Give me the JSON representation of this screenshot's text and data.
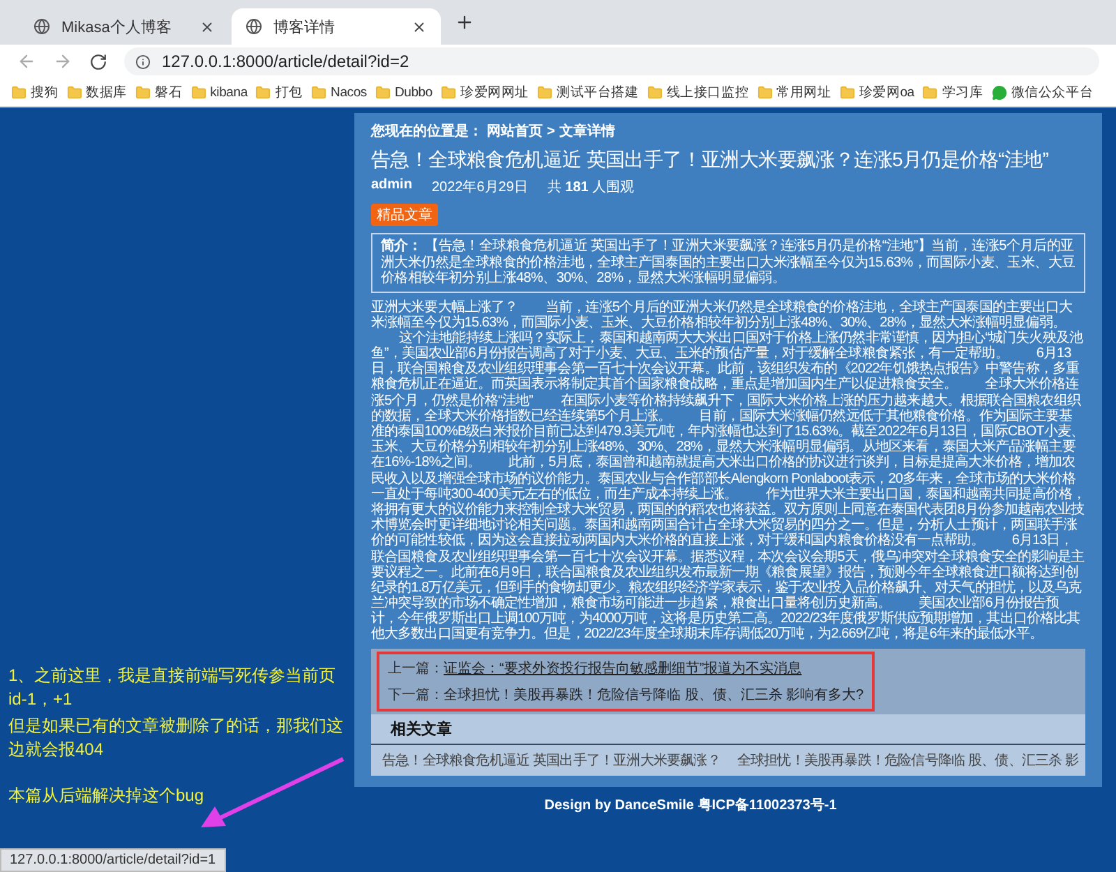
{
  "browser": {
    "tabs": [
      {
        "title": "Mikasa个人博客",
        "selected": false
      },
      {
        "title": "博客详情",
        "selected": true
      }
    ],
    "address": "127.0.0.1:8000/article/detail?id=2",
    "bookmarks": [
      {
        "label": "搜狗",
        "kind": "folder"
      },
      {
        "label": "数据库",
        "kind": "folder"
      },
      {
        "label": "磐石",
        "kind": "folder"
      },
      {
        "label": "kibana",
        "kind": "folder"
      },
      {
        "label": "打包",
        "kind": "folder"
      },
      {
        "label": "Nacos",
        "kind": "folder"
      },
      {
        "label": "Dubbo",
        "kind": "folder"
      },
      {
        "label": "珍爱网网址",
        "kind": "folder"
      },
      {
        "label": "测试平台搭建",
        "kind": "folder"
      },
      {
        "label": "线上接口监控",
        "kind": "folder"
      },
      {
        "label": "常用网址",
        "kind": "folder"
      },
      {
        "label": "珍爱网oa",
        "kind": "folder"
      },
      {
        "label": "学习库",
        "kind": "folder"
      },
      {
        "label": "微信公众平台",
        "kind": "chat"
      }
    ]
  },
  "breadcrumb": {
    "label": "您现在的位置是：",
    "items": [
      "网站首页",
      "文章详情"
    ],
    "separator": ">"
  },
  "article": {
    "title": "告急！全球粮食危机逼近 英国出手了！亚洲大米要飙涨？连涨5月仍是价格“洼地”",
    "author": "admin",
    "date": "2022年6月29日",
    "views": "共 **181** 人围观",
    "badge": "精品文章",
    "summary": "**简介：** 【告急！全球粮食危机逼近 英国出手了！亚洲大米要飙涨？连涨5月仍是价格“洼地”】当前，连涨5个月后的亚洲大米仍然是全球粮食的价格洼地，全球主产国泰国的主要出口大米涨幅至今仅为15.63%，而国际小麦、玉米、大豆价格相较年初分别上涨48%、30%、28%，显然大米涨幅明显偏弱。",
    "body": [
      "亚洲大米要大幅上涨了？",
      "当前，连涨5个月后的亚洲大米仍然是全球粮食的价格洼地，全球主产国泰国的主要出口大米涨幅至今仅为15.63%，而国际小麦、玉米、大豆价格相较年初分别上涨48%、30%、28%，显然大米涨幅明显偏弱。",
      "这个洼地能持续上涨吗？实际上，泰国和越南两大大米出口国对于价格上涨仍然非常谨慎，因为担心“城门失火殃及池鱼”，美国农业部6月份报告调高了对于小麦、大豆、玉米的预估产量，对于缓解全球粮食紧张，有一定帮助。",
      "6月13日，联合国粮食及农业组织理事会第一百七十次会议开幕。此前，该组织发布的《2022年饥饿热点报告》中警告称，多重粮食危机正在逼近。而英国表示将制定其首个国家粮食战略，重点是增加国内生产以促进粮食安全。",
      "全球大米价格连涨5个月，仍然是价格“洼地”",
      "在国际小麦等价格持续飙升下，国际大米价格上涨的压力越来越大。根据联合国粮农组织的数据，全球大米价格指数已经连续第5个月上涨。",
      "目前，国际大米涨幅仍然远低于其他粮食价格。作为国际主要基准的泰国100%B级白米报价目前已达到479.3美元/吨，年内涨幅也达到了15.63%。截至2022年6月13日，国际CBOT小麦、玉米、大豆价格分别相较年初分别上涨48%、30%、28%，显然大米涨幅明显偏弱。从地区来看，泰国大米产品涨幅主要在16%-18%之间。",
      "此前，5月底，泰国曾和越南就提高大米出口价格的协议进行谈判，目标是提高大米价格，增加农民收入以及增强全球市场的议价能力。泰国农业与合作部部长Alengkorn Ponlaboot表示，20多年来，全球市场的大米价格一直处于每吨300-400美元左右的低位，而生产成本持续上涨。",
      "作为世界大米主要出口国，泰国和越南共同提高价格，将拥有更大的议价能力来控制全球大米贸易，两国的的稻农也将获益。双方原则上同意在泰国代表团8月份参加越南农业技术博览会时更详细地讨论相关问题。泰国和越南两国合计占全球大米贸易的四分之一。但是，分析人士预计，两国联手涨价的可能性较低，因为这会直接拉动两国内大米价格的直接上涨，对于缓和国内粮食价格没有一点帮助。",
      "6月13日，联合国粮食及农业组织理事会第一百七十次会议开幕。据悉议程，本次会议会期5天，俄乌冲突对全球粮食安全的影响是主要议程之一。此前在6月9日，联合国粮食及农业组织发布最新一期《粮食展望》报告，预测今年全球粮食进口额将达到创纪录的1.8万亿美元，但到手的食物却更少。粮农组织经济学家表示，鉴于农业投入品价格飙升、对天气的担忧，以及乌克兰冲突导致的市场不确定性增加，粮食市场可能进一步趋紧，粮食出口量将创历史新高。",
      "美国农业部6月份报告预计，今年俄罗斯出口上调100万吨，为4000万吨，这将是历史第二高。2022/23年度俄罗斯供应预期增加，其出口价格比其他大多数出口国更有竞争力。但是，2022/23年度全球期末库存调低20万吨，为2.669亿吨，将是6年来的最低水平。"
    ]
  },
  "nav": [
    {
      "label": "上一篇：",
      "title": "证监会：“要求外资投行报告向敏感删细节”报道为不实消息",
      "link": true
    },
    {
      "label": "下一篇：",
      "title": "全球担忧！美股再暴跌！危险信号降临 股、债、汇三杀 影响有多大?",
      "link": false
    }
  ],
  "related": {
    "heading": "相关文章",
    "items": [
      "告急！全球粮食危机逼近 英国出手了！亚洲大米要飙涨？",
      "全球担忧！美股再暴跌！危险信号降临 股、债、汇三杀 影"
    ]
  },
  "footer": "Design by DanceSmile 粤ICP备11002373号-1",
  "annotation": {
    "lines": [
      "1、之前这里，我是直接前端写死传参当前页id-1，+1",
      "但是如果已有的文章被删除了的话，那我们这边就会报404",
      "本篇从后端解决掉这个bug"
    ]
  },
  "status_bar": "127.0.0.1:8000/article/detail?id=1"
}
